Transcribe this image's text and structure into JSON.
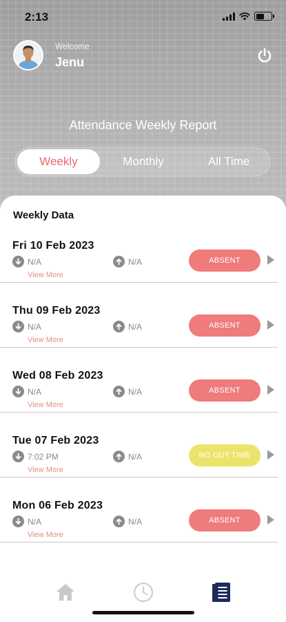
{
  "status_bar": {
    "time": "2:13"
  },
  "profile": {
    "welcome": "Welcome",
    "name": "Jenu"
  },
  "report_title": "Attendance Weekly Report",
  "tabs": [
    {
      "label": "Weekly",
      "active": true
    },
    {
      "label": "Monthly",
      "active": false
    },
    {
      "label": "All Time",
      "active": false
    }
  ],
  "section_title": "Weekly Data",
  "rows": [
    {
      "date": "Fri 10 Feb 2023",
      "in_time": "N/A",
      "out_time": "N/A",
      "view_more": "View More",
      "status": "ABSENT"
    },
    {
      "date": "Thu 09 Feb 2023",
      "in_time": "N/A",
      "out_time": "N/A",
      "view_more": "View More",
      "status": "ABSENT"
    },
    {
      "date": "Wed 08 Feb 2023",
      "in_time": "N/A",
      "out_time": "N/A",
      "view_more": "View More",
      "status": "ABSENT"
    },
    {
      "date": "Tue 07 Feb 2023",
      "in_time": "7:02 PM",
      "out_time": "N/A",
      "view_more": "View More",
      "status": "NO OUT TIME"
    },
    {
      "date": "Mon 06 Feb 2023",
      "in_time": "N/A",
      "out_time": "N/A",
      "view_more": "View More",
      "status": "ABSENT"
    }
  ],
  "colors": {
    "accent": "#e66a6a",
    "absent": "#ef7b7b",
    "no_out_time": "#ece46a",
    "nav_active": "#1f2a5a",
    "nav_inactive": "#c8c8c8"
  },
  "nav": [
    {
      "icon": "home-icon",
      "active": false
    },
    {
      "icon": "clock-icon",
      "active": false
    },
    {
      "icon": "report-icon",
      "active": true
    }
  ]
}
